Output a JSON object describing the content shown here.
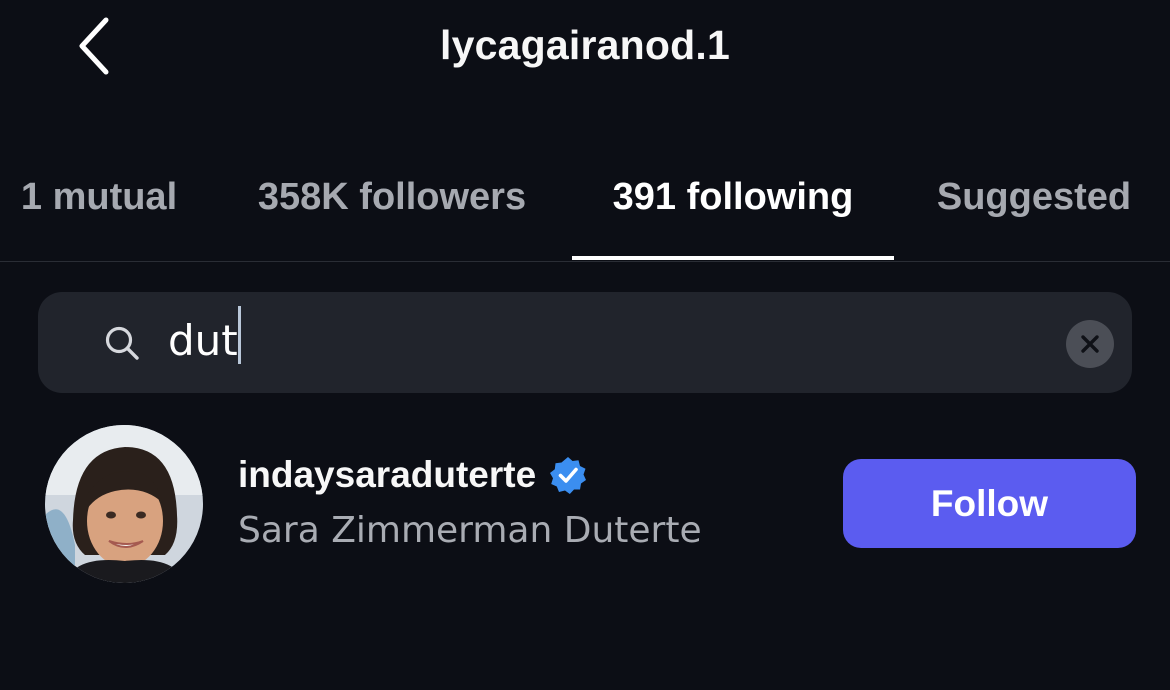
{
  "header": {
    "title": "lycagairanod.1",
    "back_icon": "chevron-left-icon"
  },
  "tabs": [
    {
      "label": "1 mutual",
      "active": false
    },
    {
      "label": "358K followers",
      "active": false
    },
    {
      "label": "391 following",
      "active": true
    },
    {
      "label": "Suggested",
      "active": false
    }
  ],
  "search": {
    "icon": "search-icon",
    "value": "dut",
    "clear_icon": "close-icon"
  },
  "results": [
    {
      "username": "indaysaraduterte",
      "verified": true,
      "full_name": "Sara Zimmerman Duterte",
      "action_label": "Follow"
    }
  ],
  "colors": {
    "background": "#0c0e15",
    "search_background": "#21242c",
    "follow_button": "#5b5cf0",
    "verified_badge": "#3b8ef0",
    "muted_text": "#a6a9b0"
  }
}
